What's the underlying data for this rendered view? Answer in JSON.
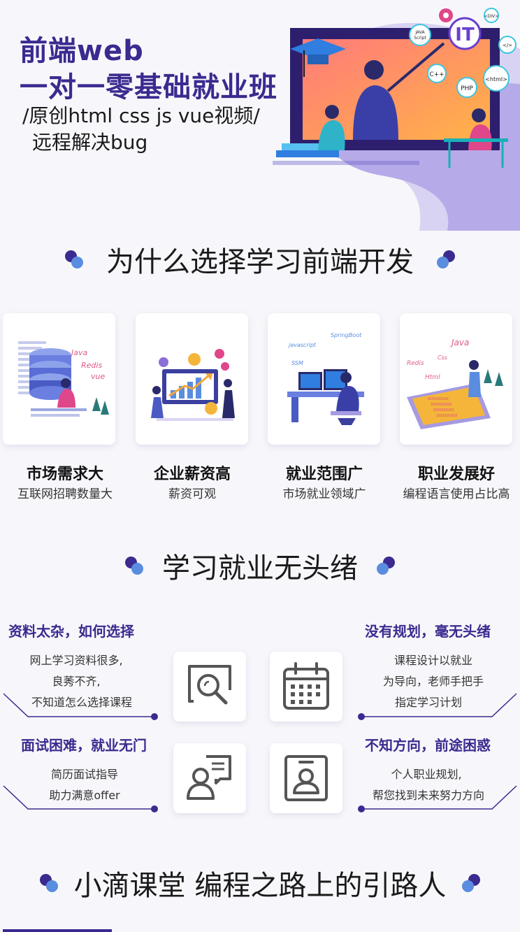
{
  "hero": {
    "title_line1": "前端web",
    "title_line2": "一对一零基础就业班",
    "subtitle_line1": "/原创html css js vue视频/",
    "subtitle_line2": "远程解决bug",
    "art_labels": [
      "IT",
      "JAVA Script",
      "C++",
      "PHP",
      "<html>",
      "<DIV>",
      "</>"
    ]
  },
  "why": {
    "title": "为什么选择学习前端开发",
    "cards": [
      {
        "title": "市场需求大",
        "sub": "互联网招聘数量大",
        "art_words": [
          "Java",
          "Redis",
          "vue"
        ]
      },
      {
        "title": "企业薪资高",
        "sub": "薪资可观",
        "art_words": []
      },
      {
        "title": "就业范围广",
        "sub": "市场就业领域广",
        "art_words": [
          "javascript",
          "SpringBoot",
          "SSM"
        ]
      },
      {
        "title": "职业发展好",
        "sub": "编程语言使用占比高",
        "art_words": [
          "Java",
          "Redis",
          "Css",
          "Html"
        ]
      }
    ]
  },
  "problems": {
    "title": "学习就业无头绪",
    "items": [
      {
        "title": "资料太杂，如何选择",
        "lines": [
          "网上学习资料很多,",
          "良莠不齐,",
          "不知道怎么选择课程"
        ],
        "icon": "search-document-icon"
      },
      {
        "title": "没有规划，毫无头绪",
        "lines": [
          "课程设计以就业",
          "为导向，老师手把手",
          "指定学习计划"
        ],
        "icon": "calendar-icon"
      },
      {
        "title": "面试困难，就业无门",
        "lines": [
          "简历面试指导",
          "助力满意offer"
        ],
        "icon": "resume-icon"
      },
      {
        "title": "不知方向，前途困惑",
        "lines": [
          "个人职业规划,",
          "帮您找到未来努力方向"
        ],
        "icon": "profile-card-icon"
      }
    ]
  },
  "footer": {
    "title": "小滴课堂 编程之路上的引路人"
  },
  "colors": {
    "brand": "#3b2a8f",
    "accent": "#5a8de0"
  }
}
